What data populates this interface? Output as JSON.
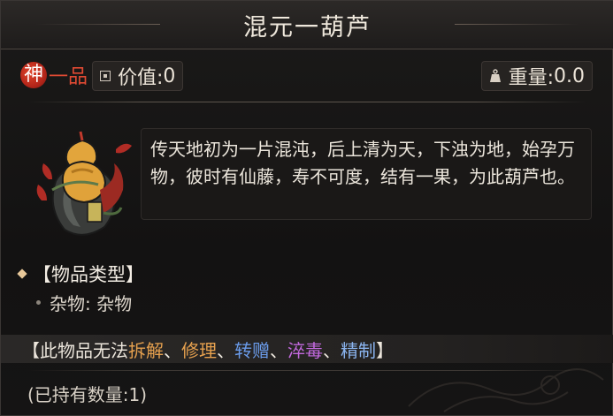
{
  "title": "混元一葫芦",
  "grade": {
    "first_char": "神",
    "rest": "一品"
  },
  "value": {
    "label": "价值:",
    "amount": "0"
  },
  "weight": {
    "label": "重量:",
    "amount": "0.0"
  },
  "description": "传天地初为一片混沌，后上清为天，下浊为地，始孕万物，彼时有仙藤，寿不可度，结有一果，为此葫芦也。",
  "category": {
    "header": "【物品类型】",
    "value": "杂物: 杂物"
  },
  "restrictions": {
    "prefix": "【此物品无法",
    "items": [
      {
        "label": "拆解",
        "color": "#e5a04e"
      },
      {
        "label": "修理",
        "color": "#e5a04e"
      },
      {
        "label": "转赠",
        "color": "#6a9bea"
      },
      {
        "label": "淬毒",
        "color": "#c46ae0"
      },
      {
        "label": "精制",
        "color": "#8ab4ef"
      }
    ],
    "separator": "、",
    "suffix": "】"
  },
  "owned": "(已持有数量:1)",
  "icons": {
    "item": "gourd-item-icon",
    "value": "coin-icon",
    "weight": "weight-icon"
  },
  "colors": {
    "grade_seal": "#c2301f",
    "grade_text": "#e04a33"
  }
}
